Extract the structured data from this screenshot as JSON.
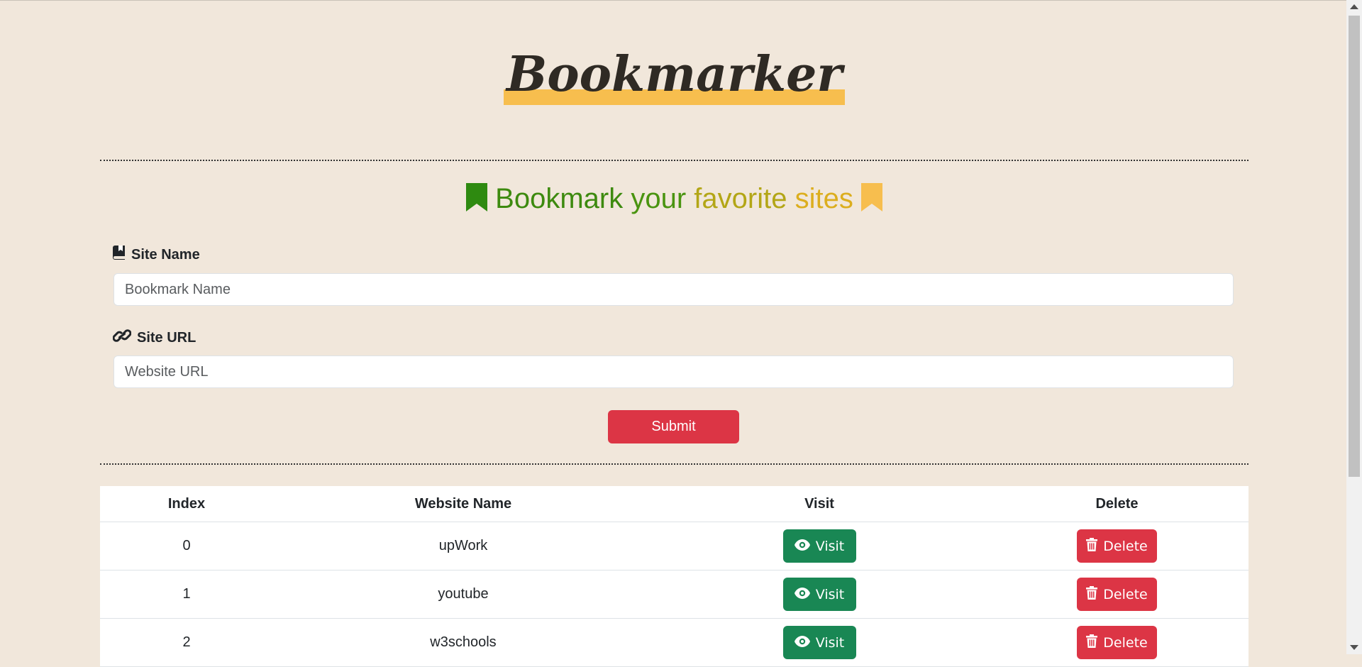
{
  "app": {
    "logo": "Bookmarker",
    "heading": {
      "words": [
        "Bookmark",
        "your",
        "favorite",
        "sites"
      ]
    }
  },
  "colors": {
    "background": "#f1e7db",
    "logo_highlight": "#f7be4e",
    "bookmark_icon_green": "#2e8a10",
    "bookmark_icon_yellow": "#f7be4e",
    "danger": "#dc3545",
    "success": "#198754"
  },
  "form": {
    "site_name_label": "Site Name",
    "site_name_icon": "book-bookmark-icon",
    "site_name_placeholder": "Bookmark Name",
    "site_name_value": "",
    "site_url_label": "Site URL",
    "site_url_icon": "link-icon",
    "site_url_placeholder": "Website URL",
    "site_url_value": "",
    "submit_label": "Submit"
  },
  "table": {
    "headers": [
      "Index",
      "Website Name",
      "Visit",
      "Delete"
    ],
    "rows": [
      {
        "index": "0",
        "name": "upWork",
        "visit_label": "Visit",
        "delete_label": "Delete"
      },
      {
        "index": "1",
        "name": "youtube",
        "visit_label": "Visit",
        "delete_label": "Delete"
      },
      {
        "index": "2",
        "name": "w3schools",
        "visit_label": "Visit",
        "delete_label": "Delete"
      }
    ],
    "visit_icon": "eye-icon",
    "delete_icon": "trash-icon"
  }
}
